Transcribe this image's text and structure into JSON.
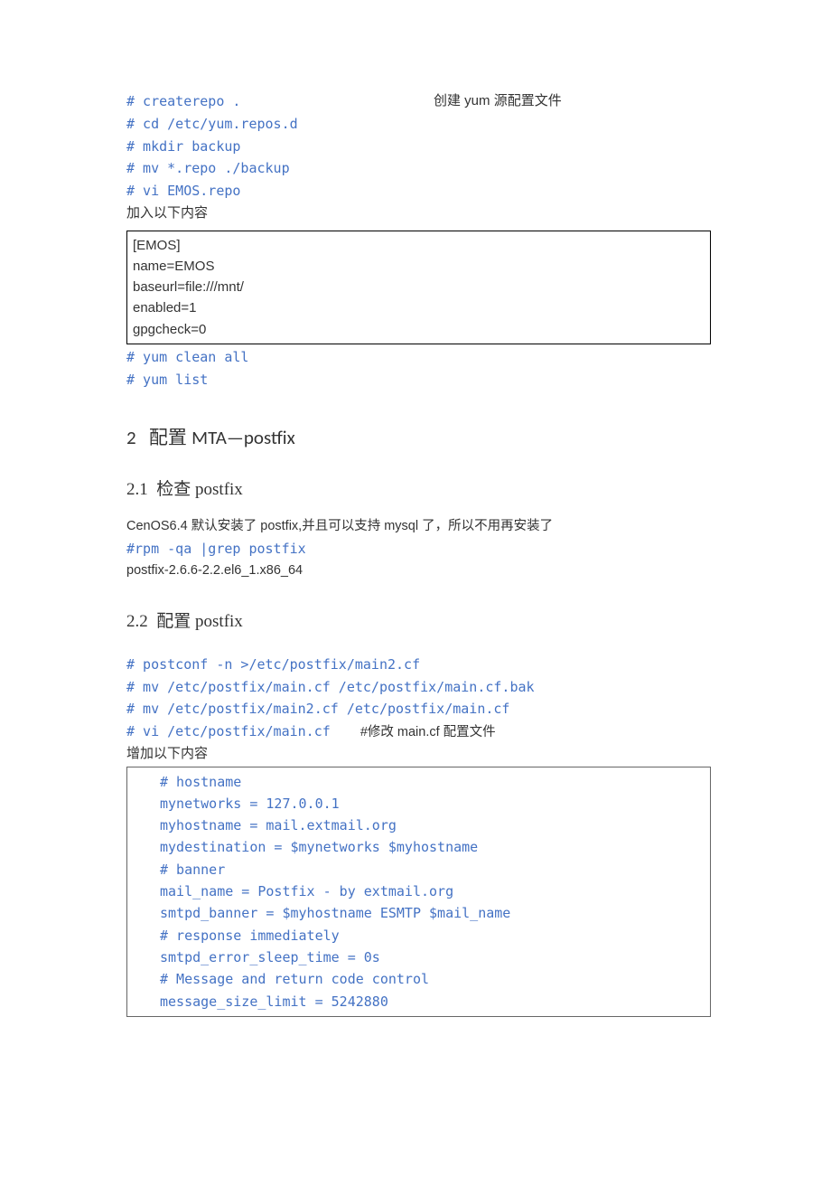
{
  "block1": {
    "line1": "# createrepo .",
    "comment1_pre": "创建 ",
    "comment1_yum": "yum ",
    "comment1_post": "源配置文件",
    "line2": "# cd /etc/yum.repos.d",
    "line3": "# mkdir backup",
    "line4": "# mv *.repo ./backup",
    "line5": "# vi EMOS.repo",
    "line6": "加入以下内容"
  },
  "box1": {
    "l1": "[EMOS]",
    "l2": "name=EMOS",
    "l3": "baseurl=file:///mnt/",
    "l4": "enabled=1",
    "l5": "gpgcheck=0"
  },
  "block2": {
    "line1": "# yum clean all",
    "line2": "# yum list"
  },
  "heading2": {
    "num": "2",
    "cn": "配置 ",
    "en": "MTA—postfix"
  },
  "heading21": {
    "num": "2.1",
    "cn": "检查 ",
    "en": "postfix"
  },
  "section21": {
    "line1": "  CenOS6.4 默认安装了 postfix,并且可以支持 mysql 了，所以不用再安装了",
    "line2": "#rpm -qa |grep postfix",
    "line3": "  postfix-2.6.6-2.2.el6_1.x86_64"
  },
  "heading22": {
    "num": "2.2",
    "cn": "配置 ",
    "en": "postfix"
  },
  "section22": {
    "l1": "# postconf -n >/etc/postfix/main2.cf",
    "l2": "# mv /etc/postfix/main.cf /etc/postfix/main.cf.bak ",
    "l3": "# mv /etc/postfix/main2.cf /etc/postfix/main.cf",
    "l4a": "# vi /etc/postfix/main.cf ",
    "l4b": "#修改 main.cf 配置文件",
    "l5": "增加以下内容"
  },
  "box2": {
    "l1": "# hostname",
    "l2": "mynetworks = 127.0.0.1",
    "l3": "myhostname = mail.extmail.org",
    "l4": "mydestination = $mynetworks $myhostname",
    "l5": "# banner ",
    "l6": "mail_name = Postfix - by extmail.org",
    "l7": "smtpd_banner = $myhostname ESMTP $mail_name",
    "l8": "# response immediately",
    "l9": "smtpd_error_sleep_time = 0s",
    "l10": "# Message and return code control",
    "l11": "message_size_limit = 5242880"
  }
}
